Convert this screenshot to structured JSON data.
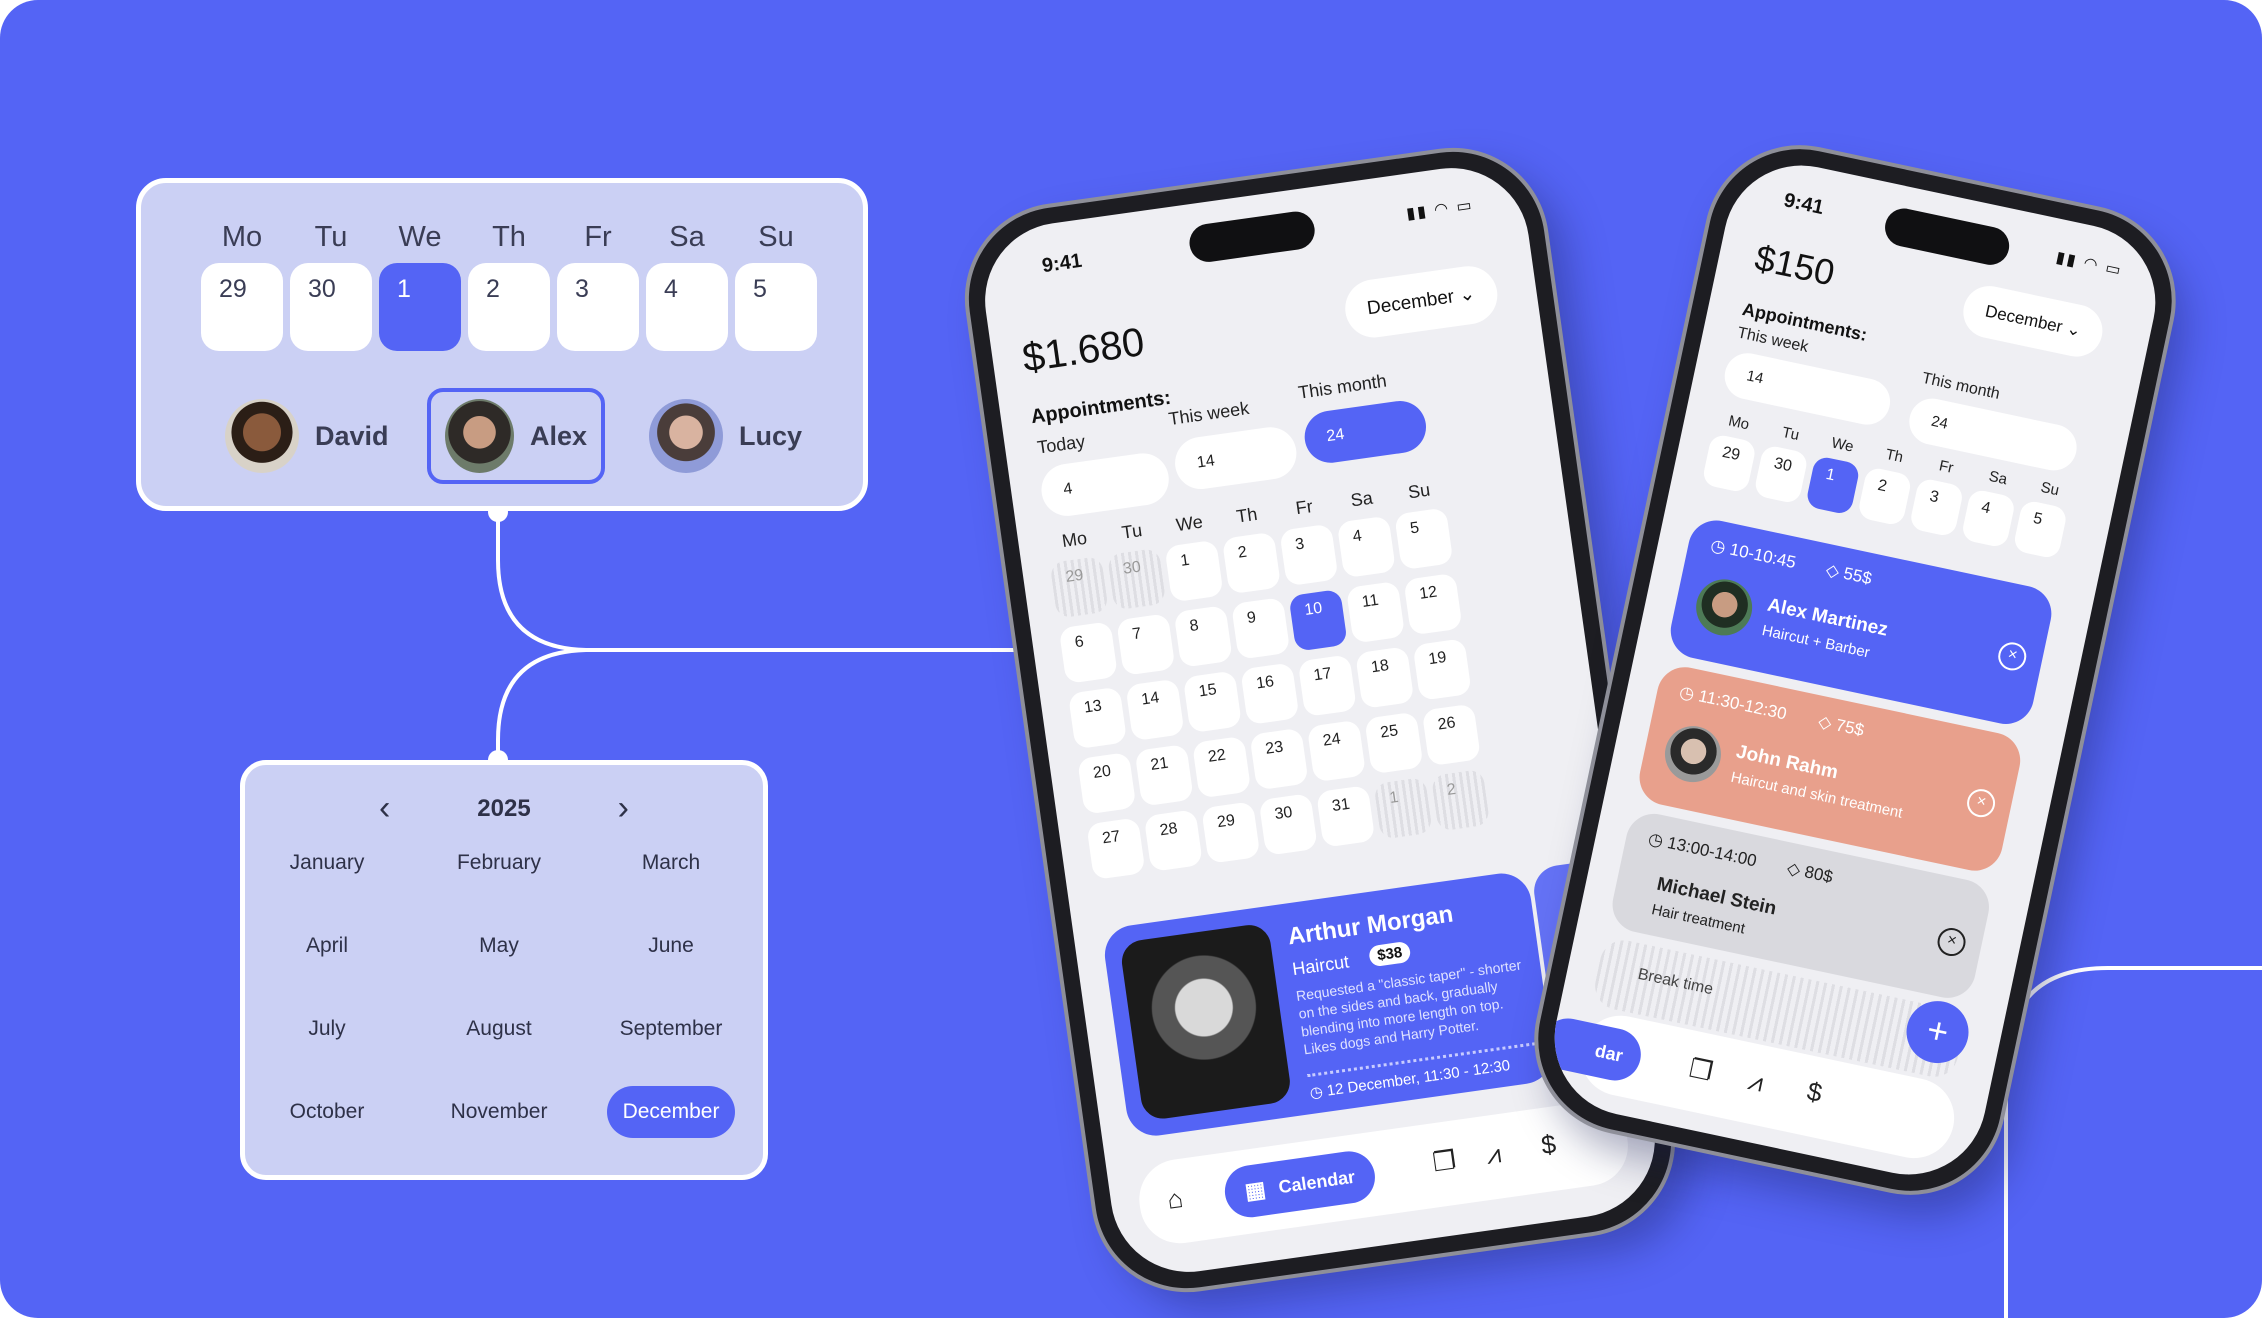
{
  "week_picker": {
    "weekdays": [
      "Mo",
      "Tu",
      "We",
      "Th",
      "Fr",
      "Sa",
      "Su"
    ],
    "days": [
      "29",
      "30",
      "1",
      "2",
      "3",
      "4",
      "5"
    ],
    "active_day": "1",
    "staff": [
      {
        "name": "David",
        "selected": false
      },
      {
        "name": "Alex",
        "selected": true
      },
      {
        "name": "Lucy",
        "selected": false
      }
    ]
  },
  "month_picker": {
    "year": "2025",
    "prev_icon": "‹",
    "next_icon": "›",
    "months": [
      "January",
      "February",
      "March",
      "April",
      "May",
      "June",
      "July",
      "August",
      "September",
      "October",
      "November",
      "December"
    ],
    "selected": "December"
  },
  "phone1": {
    "time": "9:41",
    "total": "$1.680",
    "month_select": "December",
    "appointments_title": "Appointments:",
    "tabs": [
      {
        "label": "Today",
        "count": "4",
        "active": false
      },
      {
        "label": "This week",
        "count": "14",
        "active": false
      },
      {
        "label": "This month",
        "count": "24",
        "active": true
      }
    ],
    "calendar": {
      "weekdays": [
        "Mo",
        "Tu",
        "We",
        "Th",
        "Fr",
        "Sa",
        "Su"
      ],
      "weeks": [
        [
          "29",
          "30",
          "1",
          "2",
          "3",
          "4",
          "5"
        ],
        [
          "6",
          "7",
          "8",
          "9",
          "10",
          "11",
          "12"
        ],
        [
          "13",
          "14",
          "15",
          "16",
          "17",
          "18",
          "19"
        ],
        [
          "20",
          "21",
          "22",
          "23",
          "24",
          "25",
          "26"
        ],
        [
          "27",
          "28",
          "29",
          "30",
          "31",
          "1",
          "2"
        ]
      ],
      "active": "10"
    },
    "appointment": {
      "name": "Arthur Morgan",
      "service": "Haircut",
      "price": "$38",
      "note": "Requested a \"classic taper\" - shorter on the sides and back, gradually blending into more length on top. Likes dogs and Harry Potter.",
      "date": "12 December, 11:30 - 12:30"
    },
    "nav": {
      "calendar_label": "Calendar"
    }
  },
  "phone2": {
    "time": "9:41",
    "total": "$150",
    "month_select": "December",
    "appointments_title": "Appointments:",
    "tabs": [
      {
        "label": "This week",
        "count": "14"
      },
      {
        "label": "This month",
        "count": "24"
      }
    ],
    "weekdays": [
      "Mo",
      "Tu",
      "We",
      "Th",
      "Fr",
      "Sa",
      "Su"
    ],
    "days": [
      "29",
      "30",
      "1",
      "2",
      "3",
      "4",
      "5"
    ],
    "active_day": "1",
    "appointments": [
      {
        "time": "10-10:45",
        "price": "55$",
        "name": "Alex Martinez",
        "service": "Haircut + Barber",
        "color": "#5464f5"
      },
      {
        "time": "11:30-12:30",
        "price": "75$",
        "name": "John Rahm",
        "service": "Haircut and skin treatment",
        "color": "#e8a08c"
      },
      {
        "time": "13:00-14:00",
        "price": "80$",
        "name": "Michael Stein",
        "service": "Hair treatment",
        "color": "#d9d9de"
      }
    ],
    "break_label": "Break time",
    "nav_partial": "dar"
  },
  "colors": {
    "background": "#5464f5",
    "card": "#cbd0f4",
    "accent": "#5464f5",
    "salmon": "#e8a08c"
  }
}
